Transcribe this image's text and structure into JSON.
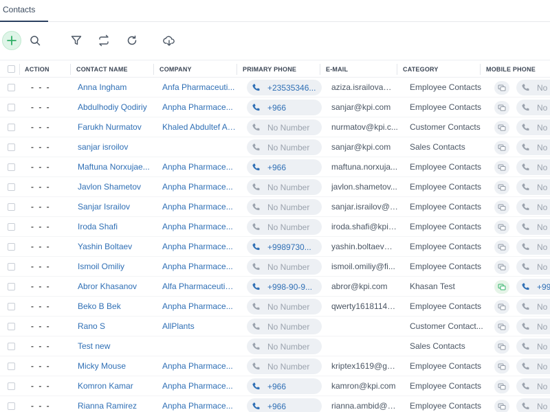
{
  "tab": {
    "label": "Contacts"
  },
  "toolbar": {
    "icons": [
      "plus-icon",
      "search-icon",
      "filter-icon",
      "swap-icon",
      "refresh-icon",
      "cloud-download-icon"
    ]
  },
  "columns": {
    "action": "ACTION",
    "contact_name": "CONTACT NAME",
    "company": "COMPANY",
    "primary_phone": "PRIMARY PHONE",
    "email": "E-MAIL",
    "category": "CATEGORY",
    "mobile_phone": "MOBILE PHONE"
  },
  "action_dots": "- - -",
  "colors": {
    "link": "#2f6fb5",
    "accent_green": "#33b36b",
    "pill_bg": "#edf0f4"
  },
  "rows": [
    {
      "name": "Anna Ingham",
      "company": "Anfa Pharmaceuti...",
      "phone": "+23535346...",
      "phone_set": true,
      "email": "aziza.israilova@fi...",
      "category": "Employee Contacts",
      "mobile": "No",
      "mobile_set": false
    },
    {
      "name": "Abdulhodiy Qodiriy",
      "company": "Anpha Pharmace...",
      "phone": "+966",
      "phone_set": true,
      "email": "sanjar@kpi.com",
      "category": "Employee Contacts",
      "mobile": "No",
      "mobile_set": false
    },
    {
      "name": "Farukh Nurmatov",
      "company": "Khaled Abdultef Al...",
      "phone": "No Number",
      "phone_set": false,
      "email": "nurmatov@kpi.c...",
      "category": "Customer Contacts",
      "mobile": "No",
      "mobile_set": false
    },
    {
      "name": "sanjar isroilov",
      "company": "",
      "phone": "No Number",
      "phone_set": false,
      "email": "sanjar@kpi.com",
      "category": "Sales Contacts",
      "mobile": "No",
      "mobile_set": false
    },
    {
      "name": "Maftuna Norxujae...",
      "company": "Anpha Pharmace...",
      "phone": "+966",
      "phone_set": true,
      "email": "maftuna.norxuja...",
      "category": "Employee Contacts",
      "mobile": "No",
      "mobile_set": false
    },
    {
      "name": "Javlon Shametov",
      "company": "Anpha Pharmace...",
      "phone": "No Number",
      "phone_set": false,
      "email": "javlon.shametov...",
      "category": "Employee Contacts",
      "mobile": "No",
      "mobile_set": false
    },
    {
      "name": "Sanjar Israilov",
      "company": "Anpha Pharmace...",
      "phone": "No Number",
      "phone_set": false,
      "email": "sanjar.israilov@fi...",
      "category": "Employee Contacts",
      "mobile": "No",
      "mobile_set": false
    },
    {
      "name": "Iroda Shafi",
      "company": "Anpha Pharmace...",
      "phone": "No Number",
      "phone_set": false,
      "email": "iroda.shafi@kpi.c...",
      "category": "Employee Contacts",
      "mobile": "No",
      "mobile_set": false
    },
    {
      "name": "Yashin Boltaev",
      "company": "Anpha Pharmace...",
      "phone": "+9989730...",
      "phone_set": true,
      "email": "yashin.boltaev@...",
      "category": "Employee Contacts",
      "mobile": "No",
      "mobile_set": false
    },
    {
      "name": "Ismoil Omiliy",
      "company": "Anpha Pharmace...",
      "phone": "No Number",
      "phone_set": false,
      "email": "ismoil.omiliy@fi...",
      "category": "Employee Contacts",
      "mobile": "No",
      "mobile_set": false
    },
    {
      "name": "Abror Khasanov",
      "company": "Alfa Pharmaceutic...",
      "phone": "+998-90-9...",
      "phone_set": true,
      "email": "abror@kpi.com",
      "category": "Khasan Test",
      "mobile": "+99",
      "mobile_set": true
    },
    {
      "name": "Beko B Bek",
      "company": "Anpha Pharmace...",
      "phone": "No Number",
      "phone_set": false,
      "email": "qwerty1618114@...",
      "category": "Employee Contacts",
      "mobile": "No",
      "mobile_set": false
    },
    {
      "name": "Rano S",
      "company": "AllPlants",
      "phone": "No Number",
      "phone_set": false,
      "email": "",
      "category": "Customer Contact...",
      "mobile": "No",
      "mobile_set": false
    },
    {
      "name": "Test new",
      "company": "",
      "phone": "No Number",
      "phone_set": false,
      "email": "",
      "category": "Sales Contacts",
      "mobile": "No",
      "mobile_set": false
    },
    {
      "name": "Micky Mouse",
      "company": "Anpha Pharmace...",
      "phone": "No Number",
      "phone_set": false,
      "email": "kriptex1619@gm...",
      "category": "Employee Contacts",
      "mobile": "No",
      "mobile_set": false
    },
    {
      "name": "Komron Kamar",
      "company": "Anpha Pharmace...",
      "phone": "+966",
      "phone_set": true,
      "email": "kamron@kpi.com",
      "category": "Employee Contacts",
      "mobile": "No",
      "mobile_set": false
    },
    {
      "name": "Rianna Ramirez",
      "company": "Anpha Pharmace...",
      "phone": "+966",
      "phone_set": true,
      "email": "rianna.ambid@g...",
      "category": "Employee Contacts",
      "mobile": "No",
      "mobile_set": false
    }
  ]
}
